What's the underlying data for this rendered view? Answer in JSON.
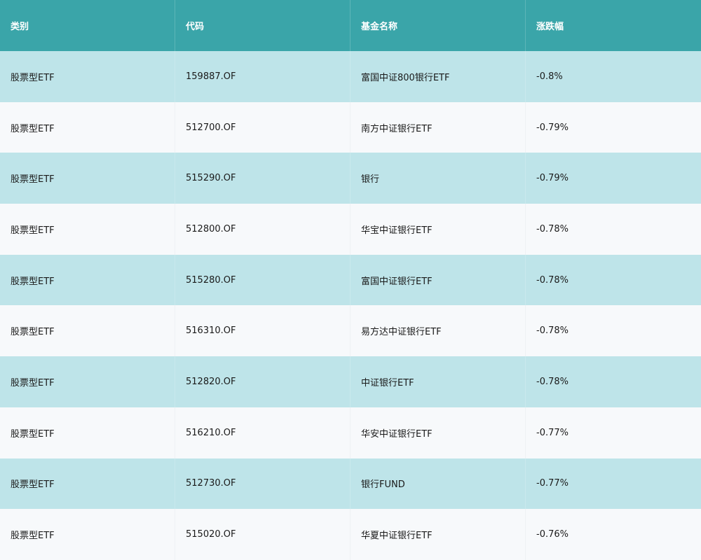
{
  "table": {
    "columns": [
      "类别",
      "代码",
      "基金名称",
      "涨跌幅"
    ],
    "rows": [
      [
        "股票型ETF",
        "159887.OF",
        "富国中证800银行ETF",
        "-0.8%"
      ],
      [
        "股票型ETF",
        "512700.OF",
        "南方中证银行ETF",
        "-0.79%"
      ],
      [
        "股票型ETF",
        "515290.OF",
        "银行",
        "-0.79%"
      ],
      [
        "股票型ETF",
        "512800.OF",
        "华宝中证银行ETF",
        "-0.78%"
      ],
      [
        "股票型ETF",
        "515280.OF",
        "富国中证银行ETF",
        "-0.78%"
      ],
      [
        "股票型ETF",
        "516310.OF",
        "易方达中证银行ETF",
        "-0.78%"
      ],
      [
        "股票型ETF",
        "512820.OF",
        "中证银行ETF",
        "-0.78%"
      ],
      [
        "股票型ETF",
        "516210.OF",
        "华安中证银行ETF",
        "-0.77%"
      ],
      [
        "股票型ETF",
        "512730.OF",
        "银行FUND",
        "-0.77%"
      ],
      [
        "股票型ETF",
        "515020.OF",
        "华夏中证银行ETF",
        "-0.76%"
      ]
    ]
  },
  "colors": {
    "header_bg": "#3aa5a9",
    "row_alt_bg": "#bee4e9",
    "row_bg": "#f7f9fb"
  }
}
